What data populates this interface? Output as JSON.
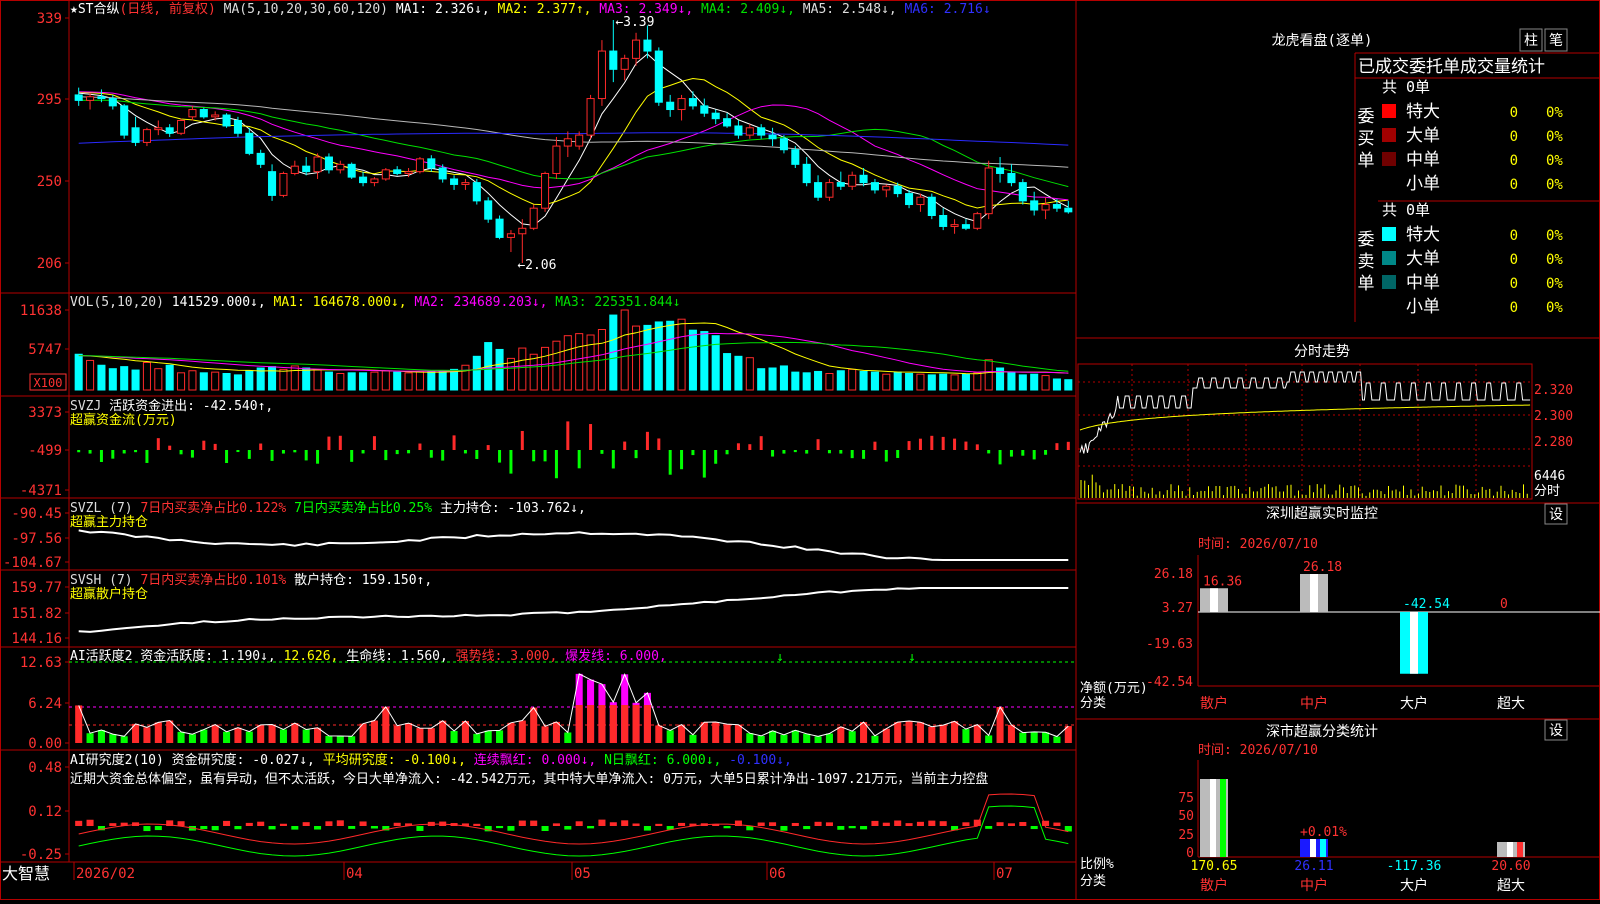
{
  "app": {
    "name": "大智慧"
  },
  "colors": {
    "up": "#ff2a2a",
    "down": "#00ffff",
    "frame": "#b40000",
    "bg": "#000000",
    "ma1": "#ffffff",
    "ma2": "#ffff00",
    "ma3": "#ff00ff",
    "ma4": "#00e000",
    "ma5": "#b8b8b8",
    "ma6": "#2a2aff",
    "green": "#00ff00",
    "yellow": "#ffff00",
    "magenta": "#ff00ff",
    "label": "#ff3232"
  },
  "panels": {
    "price": {
      "header": [
        {
          "text": "★ST合纵",
          "color": "#ffffff"
        },
        {
          "text": "(日线, 前复权)",
          "color": "#ff3232"
        },
        {
          "text": " MA(5,10,20,30,60,120) ",
          "color": "#dddddd"
        },
        {
          "text": "MA1: 2.326↓,",
          "color": "#ffffff"
        },
        {
          "text": " MA2: 2.377↑,",
          "color": "#ffff00"
        },
        {
          "text": " MA3: 2.349↓,",
          "color": "#ff00ff"
        },
        {
          "text": " MA4: 2.409↓,",
          "color": "#00e000"
        },
        {
          "text": " MA5: 2.548↓,",
          "color": "#dddddd"
        },
        {
          "text": " MA6: 2.716↓",
          "color": "#3030ff"
        }
      ],
      "axis": [
        "339",
        "295",
        "250",
        "206"
      ],
      "high_label": "←3.39",
      "low_label": "←2.06"
    },
    "vol": {
      "header": [
        {
          "text": "VOL(5,10,20) ",
          "color": "#dddddd"
        },
        {
          "text": "141529.000↓,",
          "color": "#ffffff"
        },
        {
          "text": " MA1: 164678.000↓,",
          "color": "#ffff00"
        },
        {
          "text": " MA2: 234689.203↓,",
          "color": "#ff00ff"
        },
        {
          "text": " MA3: 225351.844↓",
          "color": "#00e000"
        }
      ],
      "axis": [
        "11638",
        "5747"
      ],
      "unit": "X100"
    },
    "svzj": {
      "header": [
        {
          "text": "SVZJ  ",
          "color": "#dddddd"
        },
        {
          "text": "活跃资金进出: -42.540↑,",
          "color": "#ffffff"
        }
      ],
      "sub": "超赢资金流(万元)",
      "axis": [
        "3373",
        "-499",
        "-4371"
      ]
    },
    "svzl": {
      "header": [
        {
          "text": "SVZL (7) ",
          "color": "#dddddd"
        },
        {
          "text": "7日内买卖净占比0.122%",
          "color": "#ff3232"
        },
        {
          "text": " 7日内买卖净占比0.25%",
          "color": "#00ff00"
        },
        {
          "text": " 主力持仓: -103.762↓,",
          "color": "#ffffff"
        }
      ],
      "sub": "超赢主力持仓",
      "axis": [
        "-90.45",
        "-97.56",
        "-104.67"
      ]
    },
    "svsh": {
      "header": [
        {
          "text": "SVSH (7) ",
          "color": "#dddddd"
        },
        {
          "text": "7日内买卖净占比0.101%",
          "color": "#ff3232"
        },
        {
          "text": " 散户持仓: 159.150↑,",
          "color": "#ffffff"
        }
      ],
      "sub": "超赢散户持仓",
      "axis": [
        "159.77",
        "151.82",
        "144.16"
      ]
    },
    "ai_active": {
      "header": [
        {
          "text": "AI活跃度2 资金活跃度: 1.190↓,",
          "color": "#ffffff"
        },
        {
          "text": " 12.626,",
          "color": "#ffff00"
        },
        {
          "text": " 生命线: 1.560,",
          "color": "#ffffff"
        },
        {
          "text": " 强势线: 3.000,",
          "color": "#ff3232"
        },
        {
          "text": " 爆发线: 6.000,",
          "color": "#ff00ff"
        }
      ],
      "axis": [
        "12.63",
        "6.24",
        "0.00"
      ]
    },
    "ai_research": {
      "header": [
        {
          "text": "AI研究度2(10) 资金研究度: -0.027↓,",
          "color": "#ffffff"
        },
        {
          "text": " 平均研究度: -0.100↓,",
          "color": "#ffff00"
        },
        {
          "text": " 连续飘红: 0.000↓,",
          "color": "#ff00ff"
        },
        {
          "text": " N日飘红: 6.000↓,",
          "color": "#00ff00"
        },
        {
          "text": " -0.100↓,",
          "color": "#3030ff"
        }
      ],
      "comment": "近期大资金总体偏空，虽有异动，但不太活跃，今日大单净流入: -42.542万元，其中特大单净流入: 0万元，大单5日累计净出-1097.21万元，当前主力控盘",
      "axis": [
        "0.48",
        "0.12",
        "-0.25"
      ]
    }
  },
  "xaxis": [
    "2026/02",
    "04",
    "05",
    "06",
    "07"
  ],
  "right": {
    "lhb": {
      "title": "龙虎看盘(逐单)",
      "btn1": "柱",
      "btn2": "笔",
      "subtitle": "已成交委托单成交量统计",
      "buy": {
        "label": "委买单",
        "total": "共 0单",
        "rows": [
          {
            "name": "特大",
            "count": "0",
            "pct": "0%",
            "color": "#ff0000"
          },
          {
            "name": "大单",
            "count": "0",
            "pct": "0%",
            "color": "#a00000"
          },
          {
            "name": "中单",
            "count": "0",
            "pct": "0%",
            "color": "#700000"
          },
          {
            "name": "小单",
            "count": "0",
            "pct": "0%",
            "color": ""
          }
        ]
      },
      "sell": {
        "label": "委卖单",
        "total": "共 0单",
        "rows": [
          {
            "name": "特大",
            "count": "0",
            "pct": "0%",
            "color": "#00ffff"
          },
          {
            "name": "大单",
            "count": "0",
            "pct": "0%",
            "color": "#008888"
          },
          {
            "name": "中单",
            "count": "0",
            "pct": "0%",
            "color": "#006666"
          },
          {
            "name": "小单",
            "count": "0",
            "pct": "0%",
            "color": ""
          }
        ]
      }
    },
    "intraday": {
      "title": "分时走势",
      "axis": [
        "2.320",
        "2.300",
        "2.280"
      ],
      "vol_axis": "6446",
      "vol_unit": "分时"
    },
    "sz_monitor": {
      "title": "深圳超赢实时监控",
      "btn": "设",
      "time": "时间: 2026/07/10",
      "axis": [
        "26.18",
        "3.27",
        "-19.63",
        "-42.54"
      ],
      "ylabel1": "净额(万元)",
      "ylabel2": "分类",
      "cats": [
        "散户",
        "中户",
        "大户",
        "超大"
      ],
      "value_labels": [
        "16.36",
        "26.18",
        "-42.54",
        "0"
      ]
    },
    "sz_class": {
      "title": "深市超赢分类统计",
      "btn": "设",
      "time": "时间: 2026/07/10",
      "axis": [
        "75",
        "50",
        "25",
        "0"
      ],
      "ylabel1": "比例%",
      "ylabel2": "分类",
      "cats": [
        "散户",
        "中户",
        "大户",
        "超大"
      ],
      "vals": [
        "170.65",
        "26.11",
        "-117.36",
        "20.60"
      ],
      "extra": "+0.01%"
    }
  },
  "chart_data": [
    {
      "type": "candlestick",
      "title": "★ST合纵 (日线, 前复权)",
      "ylim": [
        2.0,
        3.4
      ],
      "x_ticks": [
        "2026/02",
        "04",
        "05",
        "06",
        "07"
      ],
      "ohlc": [
        [
          2.98,
          3.02,
          2.92,
          2.95
        ],
        [
          2.95,
          2.99,
          2.9,
          2.97
        ],
        [
          2.97,
          3.01,
          2.94,
          2.96
        ],
        [
          2.96,
          2.98,
          2.9,
          2.92
        ],
        [
          2.92,
          2.93,
          2.74,
          2.76
        ],
        [
          2.8,
          2.86,
          2.7,
          2.72
        ],
        [
          2.72,
          2.8,
          2.7,
          2.79
        ],
        [
          2.79,
          2.84,
          2.76,
          2.8
        ],
        [
          2.8,
          2.82,
          2.75,
          2.77
        ],
        [
          2.77,
          2.85,
          2.76,
          2.84
        ],
        [
          2.86,
          2.92,
          2.84,
          2.9
        ],
        [
          2.9,
          2.91,
          2.85,
          2.86
        ],
        [
          2.86,
          2.89,
          2.84,
          2.87
        ],
        [
          2.87,
          2.88,
          2.8,
          2.81
        ],
        [
          2.84,
          2.86,
          2.75,
          2.77
        ],
        [
          2.77,
          2.8,
          2.65,
          2.66
        ],
        [
          2.66,
          2.68,
          2.58,
          2.6
        ],
        [
          2.56,
          2.6,
          2.4,
          2.43
        ],
        [
          2.43,
          2.56,
          2.42,
          2.55
        ],
        [
          2.55,
          2.62,
          2.54,
          2.59
        ],
        [
          2.59,
          2.64,
          2.54,
          2.56
        ],
        [
          2.56,
          2.66,
          2.52,
          2.64
        ],
        [
          2.64,
          2.66,
          2.55,
          2.57
        ],
        [
          2.57,
          2.62,
          2.55,
          2.6
        ],
        [
          2.6,
          2.61,
          2.52,
          2.53
        ],
        [
          2.53,
          2.56,
          2.48,
          2.5
        ],
        [
          2.5,
          2.53,
          2.48,
          2.52
        ],
        [
          2.52,
          2.58,
          2.51,
          2.57
        ],
        [
          2.57,
          2.59,
          2.54,
          2.55
        ],
        [
          2.55,
          2.58,
          2.53,
          2.56
        ],
        [
          2.56,
          2.64,
          2.55,
          2.63
        ],
        [
          2.63,
          2.65,
          2.56,
          2.58
        ],
        [
          2.58,
          2.6,
          2.5,
          2.52
        ],
        [
          2.52,
          2.54,
          2.46,
          2.49
        ],
        [
          2.49,
          2.52,
          2.46,
          2.5
        ],
        [
          2.5,
          2.52,
          2.38,
          2.4
        ],
        [
          2.4,
          2.42,
          2.28,
          2.3
        ],
        [
          2.3,
          2.32,
          2.19,
          2.2
        ],
        [
          2.2,
          2.24,
          2.12,
          2.22
        ],
        [
          2.22,
          2.3,
          2.06,
          2.25
        ],
        [
          2.25,
          2.38,
          2.24,
          2.36
        ],
        [
          2.36,
          2.56,
          2.34,
          2.55
        ],
        [
          2.55,
          2.75,
          2.52,
          2.7
        ],
        [
          2.7,
          2.78,
          2.64,
          2.74
        ],
        [
          2.7,
          2.78,
          2.68,
          2.76
        ],
        [
          2.76,
          2.98,
          2.74,
          2.96
        ],
        [
          2.96,
          3.28,
          2.92,
          3.22
        ],
        [
          3.22,
          3.39,
          3.05,
          3.12
        ],
        [
          3.12,
          3.2,
          3.06,
          3.18
        ],
        [
          3.18,
          3.32,
          3.14,
          3.28
        ],
        [
          3.28,
          3.36,
          3.18,
          3.22
        ],
        [
          3.22,
          3.24,
          2.92,
          2.94
        ],
        [
          2.94,
          2.98,
          2.86,
          2.9
        ],
        [
          2.9,
          2.98,
          2.84,
          2.96
        ],
        [
          2.96,
          3.0,
          2.9,
          2.92
        ],
        [
          2.92,
          2.96,
          2.86,
          2.88
        ],
        [
          2.88,
          2.9,
          2.82,
          2.85
        ],
        [
          2.85,
          2.88,
          2.8,
          2.81
        ],
        [
          2.81,
          2.84,
          2.74,
          2.76
        ],
        [
          2.76,
          2.82,
          2.74,
          2.8
        ],
        [
          2.8,
          2.82,
          2.74,
          2.76
        ],
        [
          2.76,
          2.8,
          2.7,
          2.74
        ],
        [
          2.74,
          2.76,
          2.66,
          2.68
        ],
        [
          2.68,
          2.7,
          2.58,
          2.6
        ],
        [
          2.6,
          2.64,
          2.48,
          2.5
        ],
        [
          2.5,
          2.54,
          2.4,
          2.42
        ],
        [
          2.42,
          2.52,
          2.4,
          2.5
        ],
        [
          2.5,
          2.56,
          2.46,
          2.48
        ],
        [
          2.48,
          2.56,
          2.46,
          2.54
        ],
        [
          2.54,
          2.58,
          2.48,
          2.5
        ],
        [
          2.5,
          2.52,
          2.44,
          2.46
        ],
        [
          2.46,
          2.49,
          2.42,
          2.48
        ],
        [
          2.48,
          2.5,
          2.42,
          2.44
        ],
        [
          2.44,
          2.46,
          2.36,
          2.38
        ],
        [
          2.38,
          2.44,
          2.34,
          2.42
        ],
        [
          2.42,
          2.44,
          2.3,
          2.32
        ],
        [
          2.32,
          2.36,
          2.24,
          2.26
        ],
        [
          2.26,
          2.3,
          2.22,
          2.27
        ],
        [
          2.27,
          2.3,
          2.24,
          2.25
        ],
        [
          2.25,
          2.34,
          2.24,
          2.33
        ],
        [
          2.33,
          2.62,
          2.3,
          2.58
        ],
        [
          2.58,
          2.64,
          2.5,
          2.55
        ],
        [
          2.55,
          2.6,
          2.48,
          2.5
        ],
        [
          2.5,
          2.52,
          2.38,
          2.4
        ],
        [
          2.4,
          2.45,
          2.32,
          2.35
        ],
        [
          2.35,
          2.42,
          2.3,
          2.38
        ],
        [
          2.38,
          2.41,
          2.34,
          2.36
        ],
        [
          2.36,
          2.4,
          2.33,
          2.34
        ]
      ],
      "series": [
        {
          "name": "MA1",
          "values": [
            2.326
          ]
        },
        {
          "name": "MA2",
          "values": [
            2.377
          ]
        },
        {
          "name": "MA3",
          "values": [
            2.349
          ]
        },
        {
          "name": "MA4",
          "values": [
            2.409
          ]
        },
        {
          "name": "MA5",
          "values": [
            2.548
          ]
        },
        {
          "name": "MA6",
          "values": [
            2.716
          ]
        }
      ],
      "annotations": [
        {
          "text": "3.39",
          "x": 47
        },
        {
          "text": "2.06",
          "x": 39
        }
      ]
    },
    {
      "type": "bar",
      "title": "VOL(5,10,20)",
      "ylim": [
        0,
        11638
      ],
      "values": [
        5200,
        4300,
        3600,
        3100,
        3400,
        2900,
        4000,
        3100,
        3600,
        2500,
        2800,
        2500,
        2600,
        2400,
        2200,
        2800,
        3200,
        3400,
        3000,
        3500,
        3200,
        2900,
        2600,
        2400,
        2500,
        2500,
        2600,
        2800,
        2600,
        2500,
        2700,
        2700,
        2800,
        3000,
        3600,
        4900,
        6900,
        5900,
        4600,
        6100,
        5200,
        6200,
        7100,
        7900,
        8200,
        8000,
        8800,
        10900,
        11638,
        9300,
        9400,
        9900,
        10000,
        10300,
        8700,
        8500,
        7900,
        5300,
        4900,
        4700,
        3100,
        3200,
        3500,
        2600,
        2500,
        2700,
        2400,
        2800,
        3000,
        2700,
        2600,
        2300,
        2600,
        2400,
        2300,
        2200,
        2300,
        2200,
        2300,
        2500,
        4400,
        3200,
        2500,
        2200,
        2300,
        2100,
        1600,
        1500
      ]
    }
  ]
}
